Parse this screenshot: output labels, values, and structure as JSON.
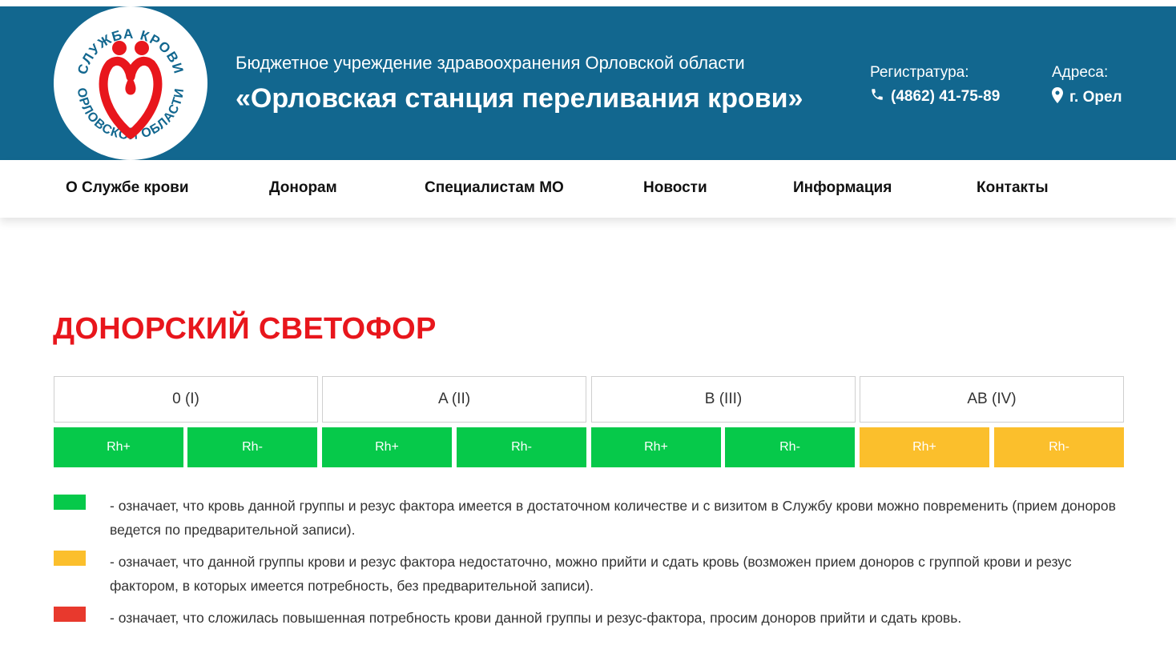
{
  "header": {
    "logo_text_top": "СЛУЖБА КРОВИ",
    "logo_text_bottom": "ОРЛОВСКОЙ ОБЛАСТИ",
    "org_subtitle": "Бюджетное учреждение здравоохранения Орловской области",
    "org_name": "«Орловская станция переливания крови»",
    "registry_label": "Регистратура:",
    "registry_phone": "(4862) 41-75-89",
    "address_label": "Адреса:",
    "address_city": "г. Орел",
    "bg_color": "#12678f"
  },
  "nav": {
    "items": [
      {
        "label": "О Службе крови"
      },
      {
        "label": "Донорам"
      },
      {
        "label": "Специалистам МО"
      },
      {
        "label": "Новости"
      },
      {
        "label": "Информация"
      },
      {
        "label": "Контакты"
      }
    ]
  },
  "page_title": "ДОНОРСКИЙ СВЕТОФОР",
  "traffic_light": {
    "groups": [
      {
        "label": "0 (I)",
        "rh": [
          {
            "label": "Rh+",
            "status": "green"
          },
          {
            "label": "Rh-",
            "status": "green"
          }
        ]
      },
      {
        "label": "A (II)",
        "rh": [
          {
            "label": "Rh+",
            "status": "green"
          },
          {
            "label": "Rh-",
            "status": "green"
          }
        ]
      },
      {
        "label": "B (III)",
        "rh": [
          {
            "label": "Rh+",
            "status": "green"
          },
          {
            "label": "Rh-",
            "status": "green"
          }
        ]
      },
      {
        "label": "AB (IV)",
        "rh": [
          {
            "label": "Rh+",
            "status": "yellow"
          },
          {
            "label": "Rh-",
            "status": "yellow"
          }
        ]
      }
    ],
    "colors": {
      "green": "#06c94a",
      "yellow": "#fbbf2c",
      "red": "#e8392d"
    }
  },
  "legend": [
    {
      "color": "#06c94a",
      "text": "- означает, что кровь данной группы и резус фактора имеется в достаточном количестве и с визитом в Службу крови можно повременить (прием доноров ведется по предварительной записи)."
    },
    {
      "color": "#fbbf2c",
      "text": "- означает, что данной группы крови и резус фактора недостаточно, можно прийти и сдать кровь (возможен прием доноров с группой крови и резус фактором, в которых имеется потребность, без предварительной записи)."
    },
    {
      "color": "#e8392d",
      "text": "- означает, что сложилась повышенная потребность крови данной группы и резус-фактора, просим доноров прийти и сдать кровь."
    }
  ]
}
